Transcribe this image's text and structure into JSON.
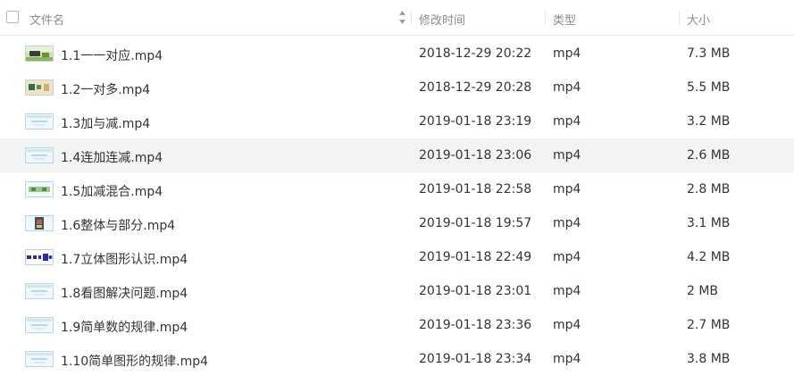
{
  "header": {
    "col_name": "文件名",
    "col_time": "修改时间",
    "col_type": "类型",
    "col_size": "大小"
  },
  "files": [
    {
      "name": "1.1一一对应.mp4",
      "time": "2018-12-29 20:22",
      "type": "mp4",
      "size": "7.3 MB",
      "thumb": "landscape-icon"
    },
    {
      "name": "1.2一对多.mp4",
      "time": "2018-12-29 20:28",
      "type": "mp4",
      "size": "5.5 MB",
      "thumb": "beige-icon"
    },
    {
      "name": "1.3加与减.mp4",
      "time": "2019-01-18 23:19",
      "type": "mp4",
      "size": "3.2 MB",
      "thumb": "light-icon"
    },
    {
      "name": "1.4连加连减.mp4",
      "time": "2019-01-18 23:06",
      "type": "mp4",
      "size": "2.6 MB",
      "thumb": "light-icon"
    },
    {
      "name": "1.5加减混合.mp4",
      "time": "2019-01-18 22:58",
      "type": "mp4",
      "size": "2.8 MB",
      "thumb": "green-icon"
    },
    {
      "name": "1.6整体与部分.mp4",
      "time": "2019-01-18 19:57",
      "type": "mp4",
      "size": "3.1 MB",
      "thumb": "dark-icon"
    },
    {
      "name": "1.7立体图形认识.mp4",
      "time": "2019-01-18 22:49",
      "type": "mp4",
      "size": "4.2 MB",
      "thumb": "shapes-icon"
    },
    {
      "name": "1.8看图解决问题.mp4",
      "time": "2019-01-18 23:01",
      "type": "mp4",
      "size": "2 MB",
      "thumb": "light-icon"
    },
    {
      "name": "1.9简单数的规律.mp4",
      "time": "2019-01-18 23:36",
      "type": "mp4",
      "size": "2.7 MB",
      "thumb": "light-icon"
    },
    {
      "name": "1.10简单图形的规律.mp4",
      "time": "2019-01-18 23:34",
      "type": "mp4",
      "size": "3.8 MB",
      "thumb": "light-icon"
    }
  ]
}
